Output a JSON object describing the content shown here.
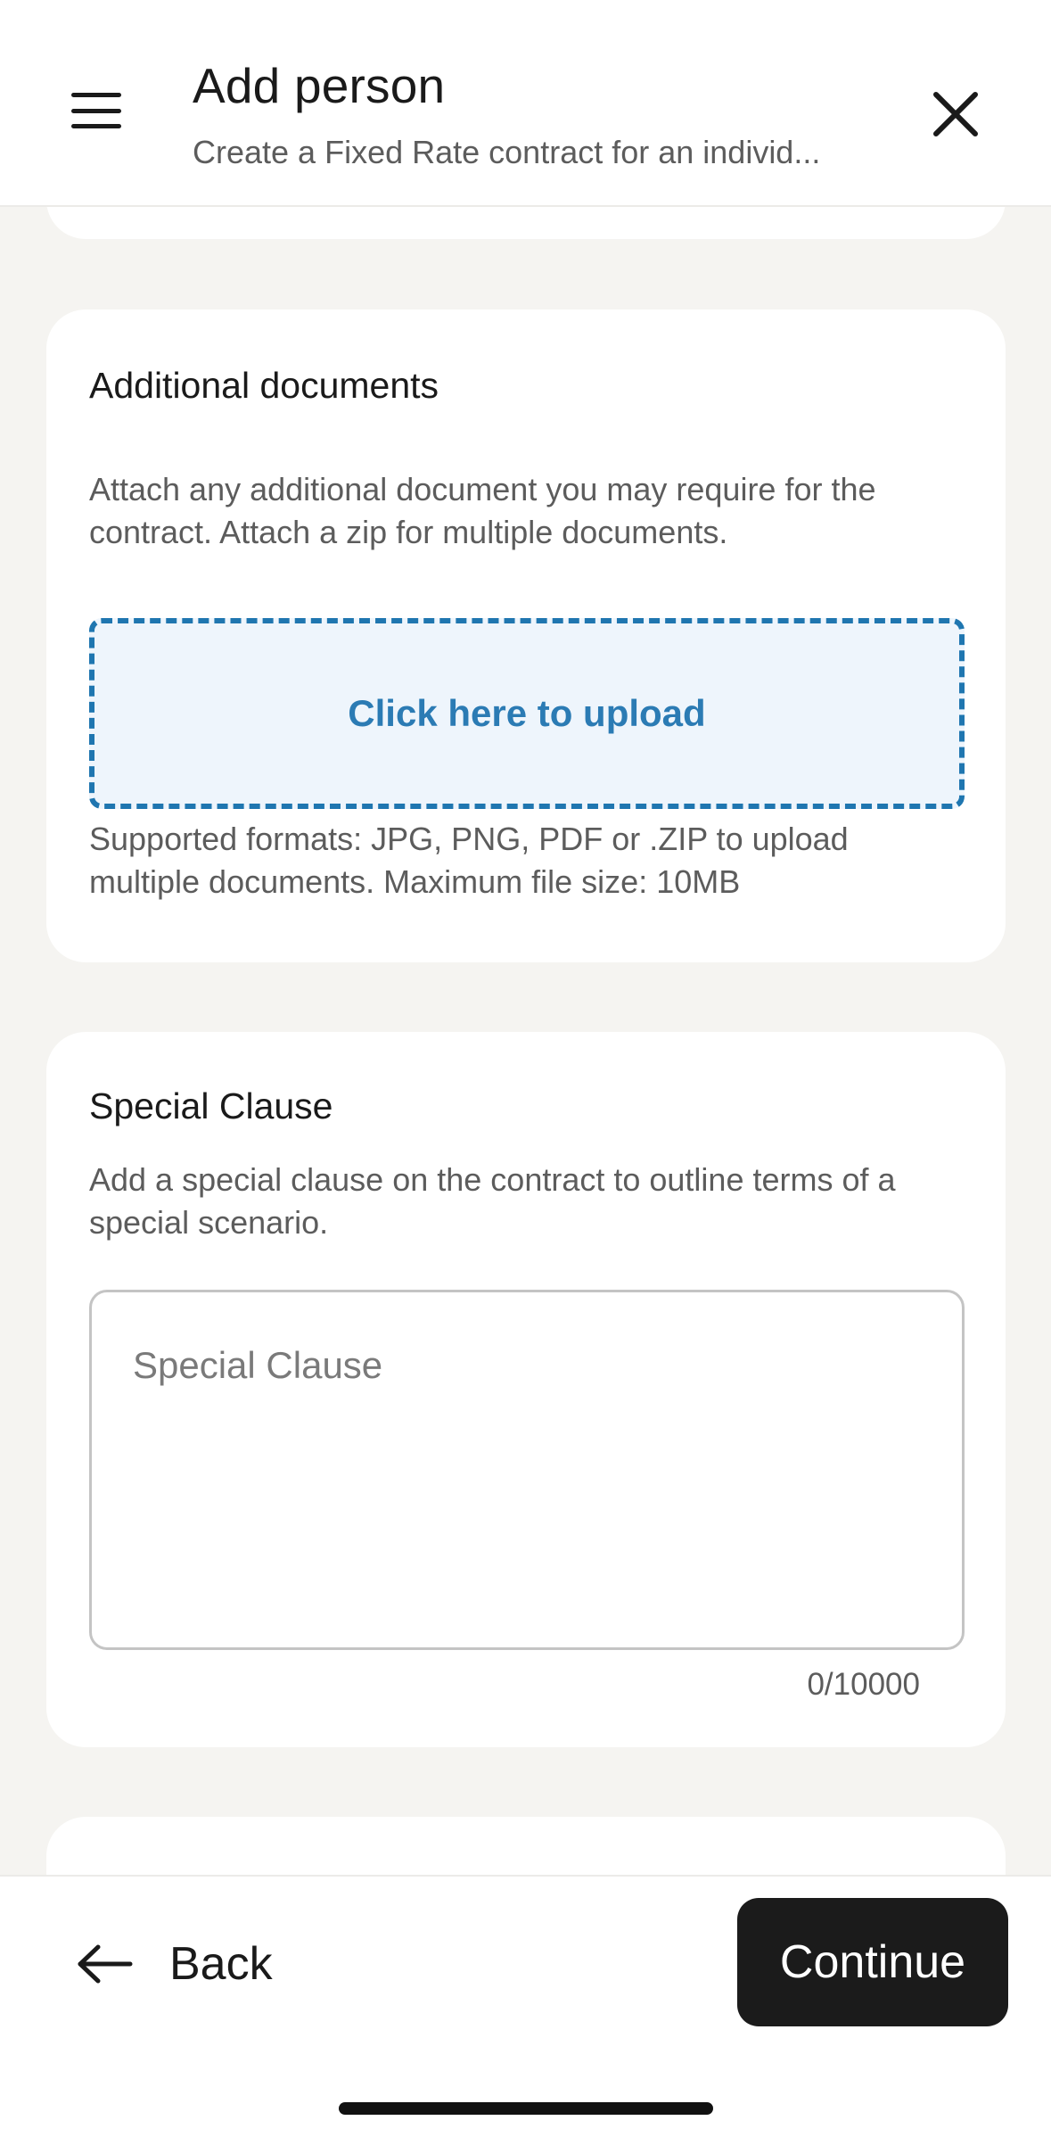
{
  "header": {
    "title": "Add person",
    "subtitle": "Create a Fixed Rate contract for an individ..."
  },
  "additional_documents": {
    "title": "Additional documents",
    "description": "Attach any additional document you may require for the contract. Attach a zip for multiple documents.",
    "upload_label": "Click here to upload",
    "supported_formats": "Supported formats: JPG, PNG, PDF or .ZIP to upload multiple documents. Maximum file size: 10MB"
  },
  "special_clause": {
    "title": "Special Clause",
    "description": "Add a special clause on the contract to outline terms of a special scenario.",
    "placeholder": "Special Clause",
    "value": "",
    "char_count": "0/10000"
  },
  "footer": {
    "back_label": "Back",
    "continue_label": "Continue"
  },
  "colors": {
    "accent": "#1f76b0",
    "upload_bg": "#eef5fc",
    "page_bg": "#f5f4f1",
    "primary_button": "#1b1b1b"
  },
  "icons": {
    "menu": "hamburger-menu-icon",
    "close": "close-icon",
    "back": "arrow-left-icon"
  }
}
